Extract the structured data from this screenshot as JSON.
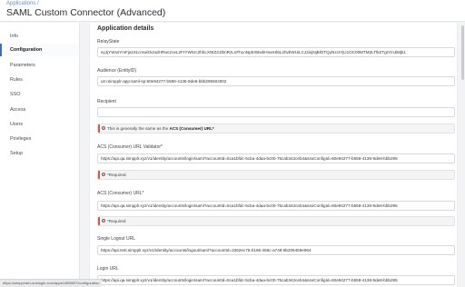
{
  "header": {
    "breadcrumb": "Applications /",
    "title": "SAML Custom Connector (Advanced)"
  },
  "sidebar": {
    "items": [
      {
        "label": "Info"
      },
      {
        "label": "Configuration"
      },
      {
        "label": "Parameters"
      },
      {
        "label": "Rules"
      },
      {
        "label": "SSO"
      },
      {
        "label": "Access"
      },
      {
        "label": "Users"
      },
      {
        "label": "Privileges"
      },
      {
        "label": "Setup"
      }
    ]
  },
  "main": {
    "section_title": "Application details",
    "fields": {
      "relaystate": {
        "label": "RelayState",
        "value": "eyJjYWxsYmFja191cmwiOiJodHRwczovL2FrYWSrc2hhLXNtZ21lbnRzLnFhLnNpbXBwbHIueHl6L2hvbWUiLCJ2iojNjBlOTQyNzctYjU1OC00MTM2LTlkZTgtYmJiMjk1"
      },
      "audience": {
        "label": "Audience (EntityID)",
        "value": "urn:simpplr-app:saml-sp:60e94277-b558-4136-9de8-bbb295604002"
      },
      "recipient": {
        "label": "Recipient",
        "value": "",
        "note_prefix": "This is generally the same as the ",
        "note_bold": "ACS (Consumer) URL*"
      },
      "acs_validator": {
        "label": "ACS (Consumer) URL Validator*",
        "value": "https://api.qa.simpplr.xyz/v1/identity/accounts/login/saml?accountId=5ca1bfdc-5cba-4daa-bc00-75cab342ceb4&ssoConfigId=60e94277-b558-4136-9de8-bbb295",
        "note": "*Required."
      },
      "acs_url": {
        "label": "ACS (Consumer) URL*",
        "value": "https://api.qa.simpplr.xyz/v1/identity/accounts/login/saml?accountId=5ca1bfdc-5cba-4daa-bc00-75cab342ceb4&ssoConfigId=60e94277-b558-4136-9de8-bbb295",
        "note": "*Required"
      },
      "single_logout": {
        "label": "Single Logout URL",
        "value": "https://api.test.simpplr.xyz/v1/identity/accounts/logout/saml?accountId=3362ec75-b166-466c-a749-9b209459e964"
      },
      "login_url": {
        "label": "Login URL",
        "value": "https://api.qa.simpplr.xyz/v1/identity/accounts/login/saml?accountId=5ca1bfdc-5cba-4daa-bc00-75cab342ceb4&ssoConfigId=60e94277-b558-4136-9de8-bbb295"
      }
    }
  },
  "statusbar": {
    "url": "https://simpplrdev.onelogin.com/apps/1898597/configuration"
  },
  "colors": {
    "accent": "#3b6fc2",
    "required_bar": "#d9534f",
    "link": "#5b8fd6"
  }
}
